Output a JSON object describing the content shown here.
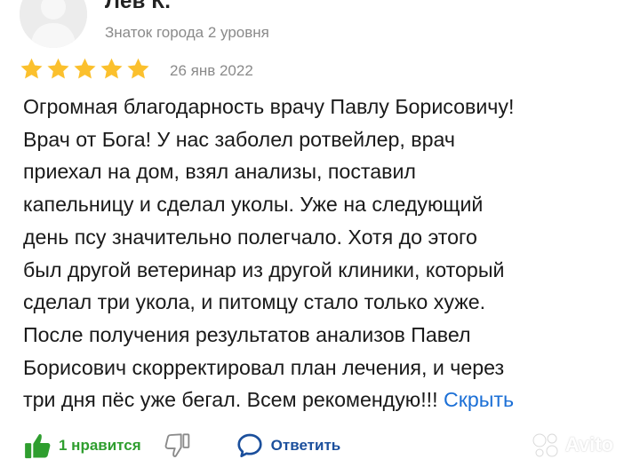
{
  "review": {
    "author_name": "Лев К.",
    "badge": "Знаток города 2 уровня",
    "rating": 5,
    "date": "26 янв 2022",
    "text_lines": [
      "Огромная благодарность врачу Павлу Борисовичу!",
      "Врач от Бога! У нас заболел ротвейлер, врач",
      "приехал на дом, взял анализы, поставил",
      "капельницу и сделал уколы. Уже на следующий",
      "день псу значительно полегчало. Хотя до этого",
      "был другой ветеринар из другой клиники, который",
      "сделал три укола, и питомцу стало только хуже.",
      "После получения результатов анализов Павел",
      "Борисович скорректировал план лечения, и через",
      "три дня пёс уже бегал. Всем рекомендую!!!"
    ],
    "hide_link": "Скрыть"
  },
  "actions": {
    "like_label": "1 нравится",
    "reply_label": "Ответить"
  },
  "watermark": {
    "text": "Avito"
  },
  "colors": {
    "star": "#fbc02d",
    "like": "#2f9e2f",
    "link": "#1b6fd6",
    "reply": "#1b4f9c",
    "muted": "#8a8a8a"
  },
  "icons": {
    "avatar": "user-avatar-placeholder",
    "star": "star-icon",
    "like": "thumbs-up-icon",
    "dislike": "thumbs-down-icon",
    "reply": "speech-bubble-icon",
    "watermark": "avito-logo-icon"
  }
}
